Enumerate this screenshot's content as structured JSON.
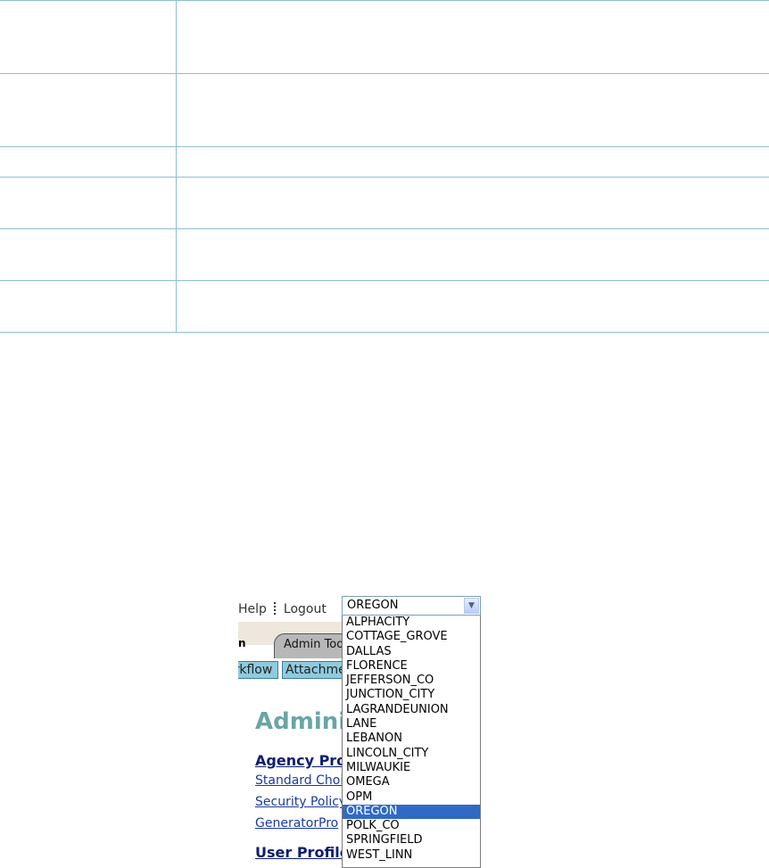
{
  "header": {
    "help_label": "Help",
    "logout_label": "Logout"
  },
  "agency_select": {
    "selected": "OREGON",
    "options": [
      "ALPHACITY",
      "COTTAGE_GROVE",
      "DALLAS",
      "FLORENCE",
      "JEFFERSON_CO",
      "JUNCTION_CITY",
      "LAGRANDEUNION",
      "LANE",
      "LEBANON",
      "LINCOLN_CITY",
      "MILWAUKIE",
      "OMEGA",
      "OPM",
      "OREGON",
      "POLK_CO",
      "SPRINGFIELD",
      "WEST_LINN"
    ],
    "selected_index": 13
  },
  "tabs": {
    "left_fragment": "n",
    "admin_tools": "Admin Tools"
  },
  "subtabs": {
    "workflow": "Workflow",
    "attachments": "Attachments"
  },
  "main": {
    "title": "Administration",
    "agency_profile": "Agency Profile",
    "standard_choices": "Standard Choices",
    "security_policy": "Security Policy",
    "generator": "Generator",
    "pro": "Pro",
    "user_profile": "User Profile"
  },
  "colors": {
    "table_line": "#8ec0cf",
    "highlight": "#316ac5",
    "title": "#6aa5a5",
    "section": "#0b1e6e"
  }
}
